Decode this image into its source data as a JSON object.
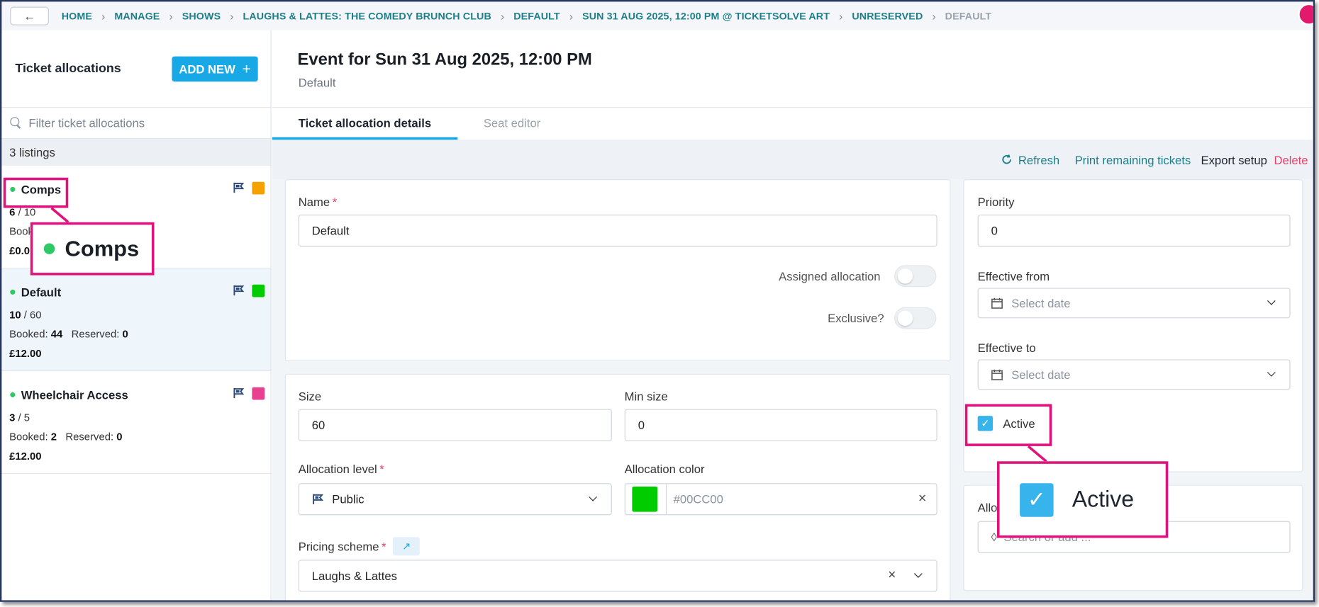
{
  "breadcrumb": {
    "items": [
      "HOME",
      "MANAGE",
      "SHOWS",
      "LAUGHS & LATTES: THE COMEDY BRUNCH CLUB",
      "DEFAULT",
      "SUN 31 AUG 2025, 12:00 PM @ TICKETSOLVE ART",
      "UNRESERVED"
    ],
    "current": "DEFAULT"
  },
  "sidebar": {
    "title": "Ticket allocations",
    "add_new_label": "ADD NEW",
    "filter_placeholder": "Filter ticket allocations",
    "listings_count": "3 listings",
    "items": [
      {
        "name": "Comps",
        "count_a": "6",
        "count_b": "10",
        "booked_label": "Book",
        "booked": "",
        "reserved_label": "",
        "reserved": "",
        "price": "£0.0",
        "color": "#f5a100"
      },
      {
        "name": "Default",
        "count_a": "10",
        "count_b": "60",
        "booked_label": "Booked:",
        "booked": "44",
        "reserved_label": "Reserved:",
        "reserved": "0",
        "price": "£12.00",
        "color": "#00cc00"
      },
      {
        "name": "Wheelchair Access",
        "count_a": "3",
        "count_b": "5",
        "booked_label": "Booked:",
        "booked": "2",
        "reserved_label": "Reserved:",
        "reserved": "0",
        "price": "£12.00",
        "color": "#e8418f"
      }
    ]
  },
  "event": {
    "title": "Event for Sun 31 Aug 2025, 12:00 PM",
    "subtitle": "Default"
  },
  "tabs": [
    "Ticket allocation details",
    "Seat editor"
  ],
  "actions": {
    "refresh": "Refresh",
    "print": "Print remaining tickets",
    "export": "Export setup",
    "delete": "Delete"
  },
  "form": {
    "name_label": "Name",
    "name_value": "Default",
    "assigned_label": "Assigned allocation",
    "exclusive_label": "Exclusive?",
    "size_label": "Size",
    "size_value": "60",
    "min_size_label": "Min size",
    "min_size_value": "0",
    "level_label": "Allocation level",
    "level_value": "Public",
    "color_label": "Allocation color",
    "color_value": "#00CC00",
    "color_swatch": "#00cc00",
    "pricing_label": "Pricing scheme",
    "pricing_value": "Laughs & Lattes",
    "priority_label": "Priority",
    "priority_value": "0",
    "eff_from_label": "Effective from",
    "eff_from_placeholder": "Select date",
    "eff_to_label": "Effective to",
    "eff_to_placeholder": "Select date",
    "active_label": "Active",
    "allo_label_partial": "Allo",
    "search_placeholder_partial": "Search or add ..."
  },
  "callouts": {
    "comps_zoom": "Comps",
    "active_zoom": "Active"
  },
  "colors": {
    "accent": "#19a8e6",
    "link": "#1d7f8a",
    "highlight": "#e0137d",
    "delete": "#e0436b"
  }
}
